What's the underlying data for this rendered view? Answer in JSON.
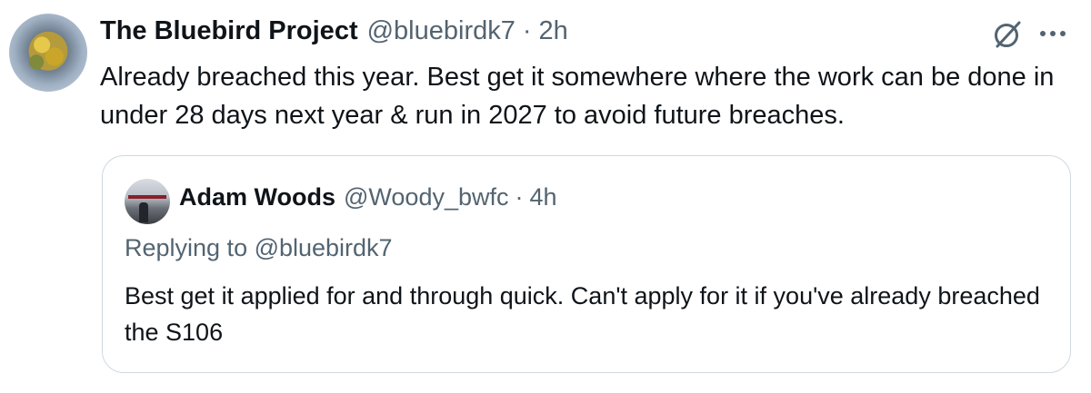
{
  "tweet": {
    "display_name": "The Bluebird Project",
    "handle": "@bluebirdk7",
    "separator": "·",
    "time": "2h",
    "text": "Already breached this year. Best get it somewhere where the work can be done in under 28 days next year & run in 2027 to avoid future breaches.",
    "icons": {
      "grok": "grok-icon",
      "more": "more-icon"
    }
  },
  "quote": {
    "display_name": "Adam Woods",
    "handle": "@Woody_bwfc",
    "separator": "·",
    "time": "4h",
    "replying_to": "Replying to @bluebirdk7",
    "text": "Best get it applied for and through quick. Can't apply for it if you've already breached the S106"
  },
  "colors": {
    "text_primary": "#0f1419",
    "text_secondary": "#536471",
    "border": "#cfd9de"
  }
}
